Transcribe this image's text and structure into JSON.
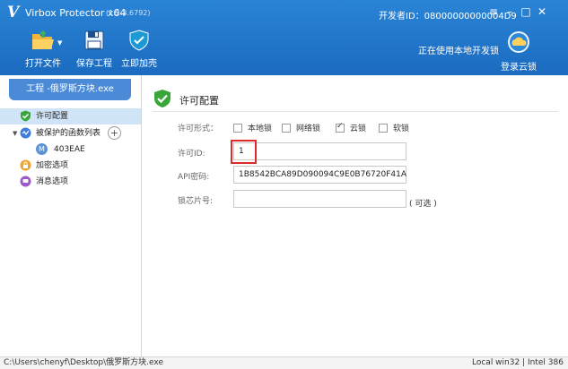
{
  "window": {
    "title": "Virbox Protector x64",
    "version": "(1.2.3.6792)",
    "developer_id": "开发者ID：08000000000004D9",
    "controls": {
      "menu": "≡",
      "minimize": "–",
      "maximize": "□",
      "close": "✕"
    }
  },
  "toolbar": {
    "open_file": "打开文件",
    "save_project": "保存工程",
    "protect_now": "立即加壳"
  },
  "header": {
    "status": "正在使用本地开发锁",
    "cloud_login": "登录云锁"
  },
  "sidebar": {
    "project_tab": "工程 -俄罗斯方块.exe",
    "items": [
      {
        "label": "许可配置"
      },
      {
        "label": "被保护的函数列表"
      },
      {
        "label": "403EAE",
        "badge": "M"
      },
      {
        "label": "加密选项"
      },
      {
        "label": "消息选项"
      }
    ],
    "add_symbol": "+"
  },
  "main": {
    "section_title": "许可配置",
    "license_form_label": "许可形式：",
    "lock_types": [
      {
        "label": "本地锁",
        "checked": false
      },
      {
        "label": "网络锁",
        "checked": false
      },
      {
        "label": "云锁",
        "checked": true
      },
      {
        "label": "软锁",
        "checked": false
      }
    ],
    "license_id_label": "许可ID:",
    "license_id_value": "1",
    "api_key_label": "API密码:",
    "api_key_value": "1B8542BCA89D090094C9E0B76720F41A",
    "chip_id_label": "锁芯片号:",
    "chip_id_value": "",
    "optional_note": "( 可选 )"
  },
  "statusbar": {
    "path": "C:\\Users\\chenyf\\Desktop\\俄罗斯方块.exe",
    "arch": "Local win32  |  Intel 386"
  },
  "colors": {
    "header": "#2377cc",
    "selection": "#cfe4f7",
    "highlight": "#e02a2a",
    "shield_green": "#3aa63a"
  }
}
